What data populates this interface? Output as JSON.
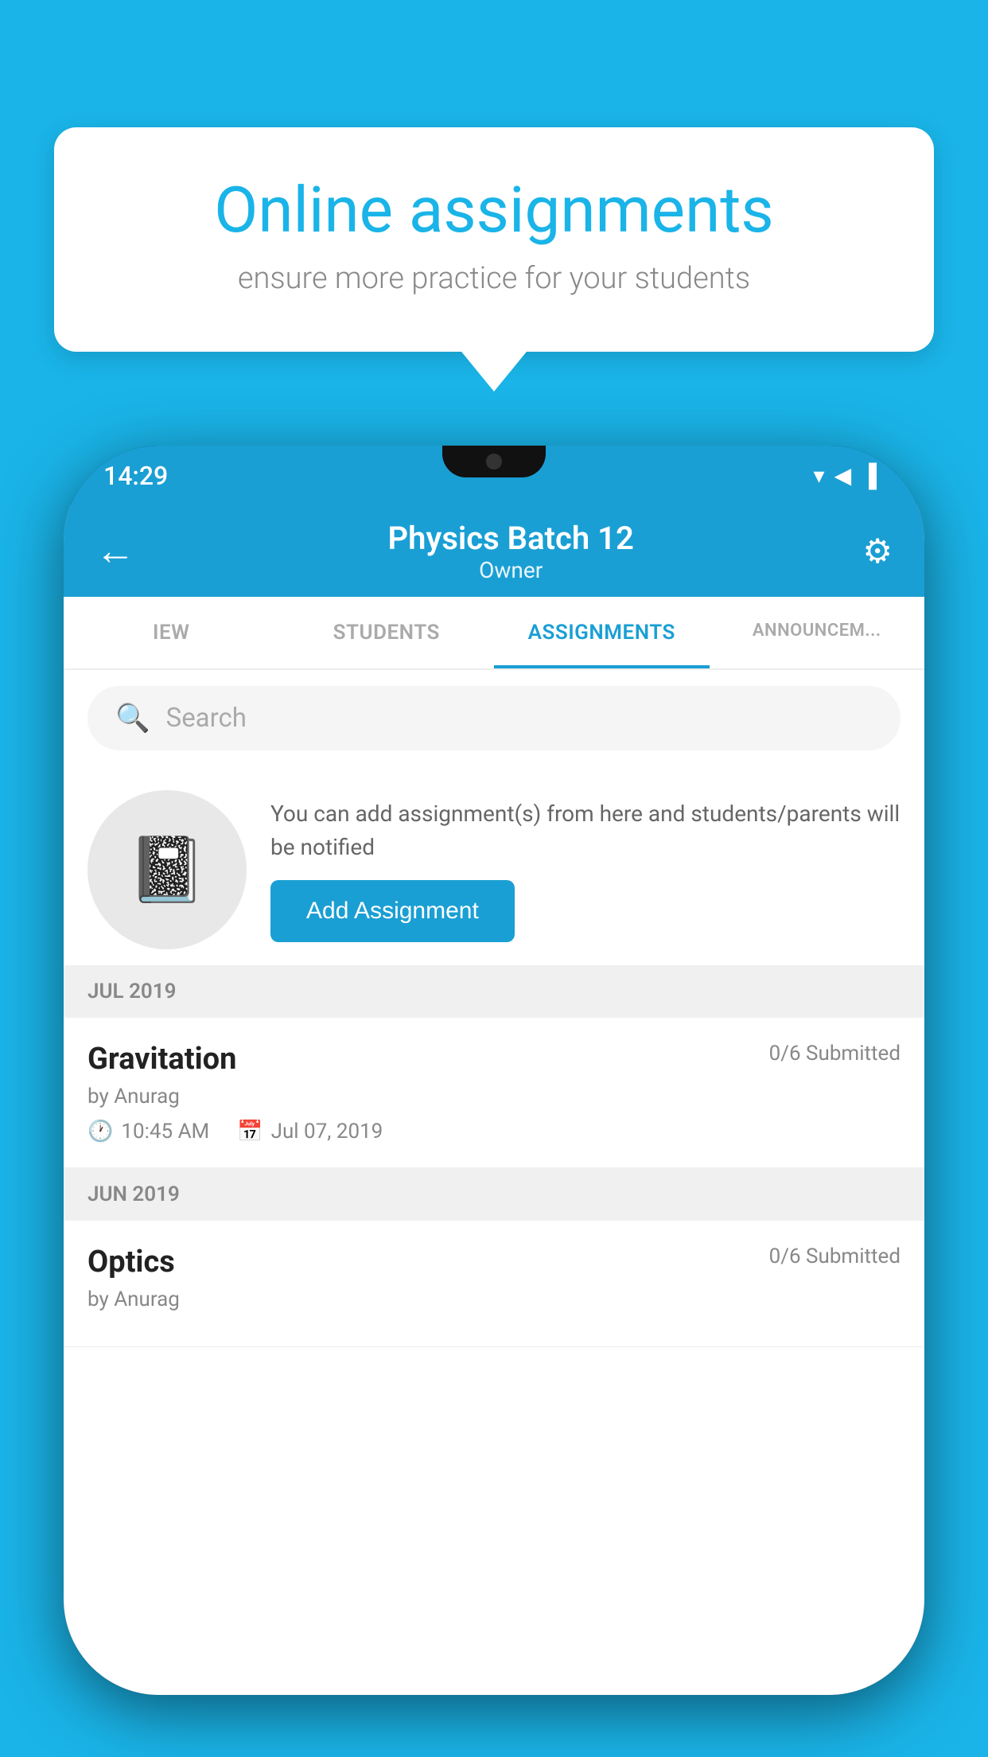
{
  "background_color": "#1ab4e8",
  "speech_bubble": {
    "title": "Online assignments",
    "subtitle": "ensure more practice for your students"
  },
  "phone": {
    "status_bar": {
      "time": "14:29",
      "signal_icons": "▼◀▐"
    },
    "app_bar": {
      "title": "Physics Batch 12",
      "subtitle": "Owner",
      "back_icon": "←",
      "settings_icon": "⚙"
    },
    "tabs": [
      {
        "label": "IEW",
        "active": false
      },
      {
        "label": "STUDENTS",
        "active": false
      },
      {
        "label": "ASSIGNMENTS",
        "active": true
      },
      {
        "label": "ANNOUNCEM...",
        "active": false
      }
    ],
    "search": {
      "placeholder": "Search"
    },
    "add_assignment_section": {
      "description": "You can add assignment(s) from here and students/parents will be notified",
      "button_label": "Add Assignment"
    },
    "sections": [
      {
        "header": "JUL 2019",
        "items": [
          {
            "title": "Gravitation",
            "submitted": "0/6 Submitted",
            "by": "by Anurag",
            "time": "10:45 AM",
            "date": "Jul 07, 2019"
          }
        ]
      },
      {
        "header": "JUN 2019",
        "items": [
          {
            "title": "Optics",
            "submitted": "0/6 Submitted",
            "by": "by Anurag",
            "time": "",
            "date": ""
          }
        ]
      }
    ]
  }
}
